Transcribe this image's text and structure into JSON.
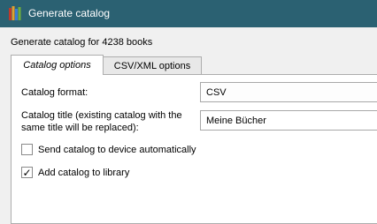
{
  "window": {
    "title": "Generate catalog",
    "icon": "books-icon",
    "titlebar_color": "#2b6172"
  },
  "heading": "Generate catalog for 4238 books",
  "tabs": [
    {
      "label": "Catalog options",
      "active": true
    },
    {
      "label": "CSV/XML options",
      "active": false
    }
  ],
  "form": {
    "format_label": "Catalog format:",
    "format_value": "CSV",
    "title_label_line1": "Catalog title (existing catalog with the",
    "title_label_line2": "same title will be replaced):",
    "title_value": "Meine Bücher",
    "send_label": "Send catalog to device automatically",
    "send_checked": false,
    "add_label": "Add catalog to library",
    "add_checked": true
  }
}
